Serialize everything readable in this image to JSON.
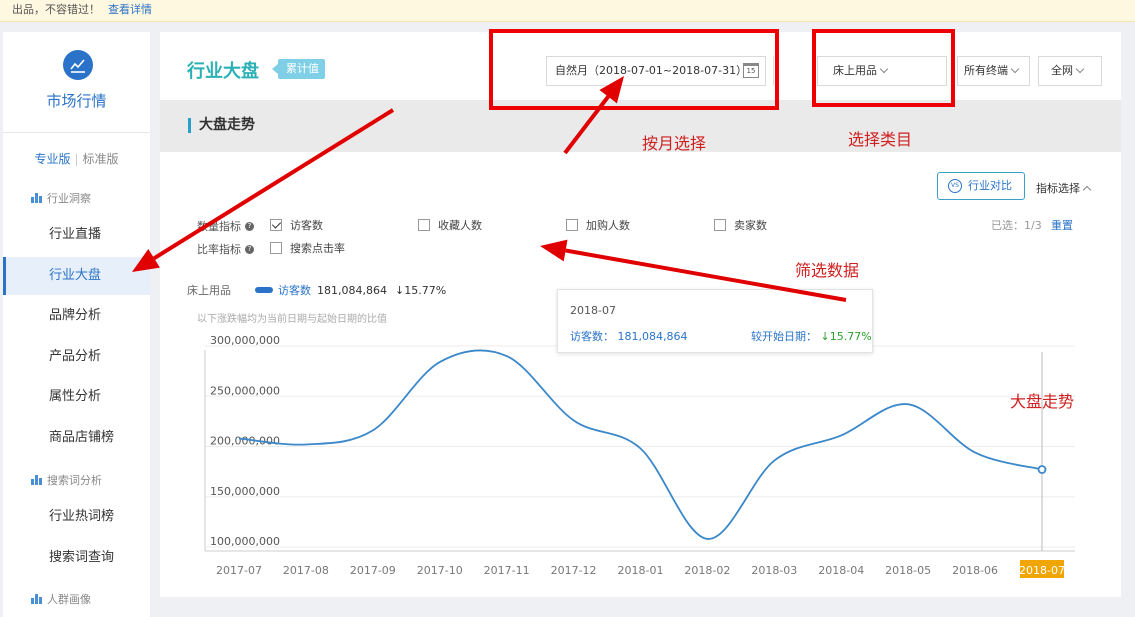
{
  "notice": {
    "text": "出品，不容错过！",
    "link": "查看详情"
  },
  "sidebar": {
    "brand": "市场行情",
    "tabs": {
      "pro": "专业版",
      "std": "标准版"
    },
    "groups": [
      "行业洞察",
      "搜索词分析",
      "人群画像"
    ],
    "items": [
      "行业直播",
      "行业大盘",
      "品牌分析",
      "产品分析",
      "属性分析",
      "商品店铺榜",
      "行业热词榜",
      "搜索词查询"
    ],
    "active_item": "行业大盘"
  },
  "header": {
    "title": "行业大盘",
    "tag": "累计值",
    "date_range": "自然月（2018-07-01~2018-07-31）",
    "calendar_day": "15",
    "category": "床上用品",
    "terminal": "所有终端",
    "network": "全网"
  },
  "section": {
    "title": "大盘走势"
  },
  "panel": {
    "compare_button": "行业对比",
    "vs_icon_text": "VS",
    "metric_toggle": "指标选择",
    "row1_label": "数量指标",
    "row2_label": "比率指标",
    "checkboxes": [
      {
        "label": "访客数",
        "checked": true
      },
      {
        "label": "收藏人数",
        "checked": false
      },
      {
        "label": "加购人数",
        "checked": false
      },
      {
        "label": "卖家数",
        "checked": false
      },
      {
        "label": "搜索点击率",
        "checked": false
      }
    ],
    "selected_count": "已选：1/3",
    "reset": "重置",
    "legend_category": "床上用品",
    "legend_series": "访客数",
    "legend_value": "181,084,864",
    "legend_change": "↓15.77%",
    "note": "以下涨跌幅均为当前日期与起始日期的比值"
  },
  "tooltip": {
    "date": "2018-07",
    "label": "访客数：",
    "value": "181,084,864",
    "change_label": "较开始日期：",
    "change": "↓15.77%"
  },
  "annotations": {
    "month_select": "按月选择",
    "category_select": "选择类目",
    "filter_data": "筛选数据",
    "trend": "大盘走势"
  },
  "colors": {
    "accent": "#2a73c8",
    "line": "#3a87c9",
    "highlight": "#f0a500",
    "annot": "#e00000"
  },
  "chart_data": {
    "type": "line",
    "categories": [
      "2017-07",
      "2017-08",
      "2017-09",
      "2017-10",
      "2017-11",
      "2017-12",
      "2018-01",
      "2018-02",
      "2018-03",
      "2018-04",
      "2018-05",
      "2018-06",
      "2018-07"
    ],
    "series": [
      {
        "name": "访客数",
        "values": [
          212000000,
          206000000,
          220000000,
          288000000,
          294000000,
          230000000,
          202000000,
          112000000,
          190000000,
          215000000,
          246000000,
          198000000,
          181084864
        ]
      }
    ],
    "yticks": [
      "100,000,000",
      "150,000,000",
      "200,000,000",
      "250,000,000",
      "300,000,000"
    ],
    "ylim": [
      100000000,
      300000000
    ],
    "highlight_category": "2018-07",
    "grid": true
  }
}
